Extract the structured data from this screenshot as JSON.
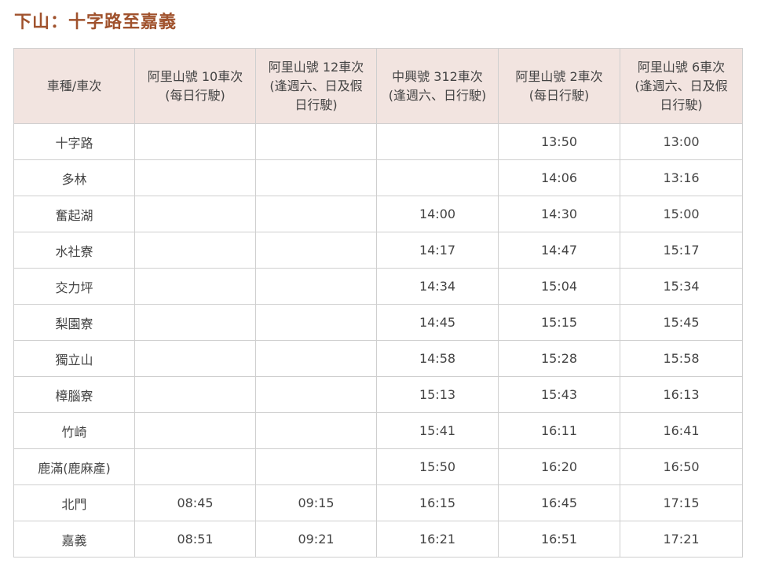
{
  "title": "下山：十字路至嘉義",
  "table": {
    "headers": [
      {
        "lines": [
          "車種/車次"
        ]
      },
      {
        "lines": [
          "阿里山號 10車次",
          "(每日行駛)"
        ]
      },
      {
        "lines": [
          "阿里山號 12車次",
          "(逢週六、日及假",
          "日行駛)"
        ]
      },
      {
        "lines": [
          "中興號 312車次",
          "(逢週六、日行駛)"
        ]
      },
      {
        "lines": [
          "阿里山號 2車次",
          "(每日行駛)"
        ]
      },
      {
        "lines": [
          "阿里山號 6車次",
          "(逢週六、日及假",
          "日行駛)"
        ]
      }
    ],
    "rows": [
      {
        "station": "十字路",
        "times": [
          "",
          "",
          "",
          "13:50",
          "13:00"
        ]
      },
      {
        "station": "多林",
        "times": [
          "",
          "",
          "",
          "14:06",
          "13:16"
        ]
      },
      {
        "station": "奮起湖",
        "times": [
          "",
          "",
          "14:00",
          "14:30",
          "15:00"
        ]
      },
      {
        "station": "水社寮",
        "times": [
          "",
          "",
          "14:17",
          "14:47",
          "15:17"
        ]
      },
      {
        "station": "交力坪",
        "times": [
          "",
          "",
          "14:34",
          "15:04",
          "15:34"
        ]
      },
      {
        "station": "梨園寮",
        "times": [
          "",
          "",
          "14:45",
          "15:15",
          "15:45"
        ]
      },
      {
        "station": "獨立山",
        "times": [
          "",
          "",
          "14:58",
          "15:28",
          "15:58"
        ]
      },
      {
        "station": "樟腦寮",
        "times": [
          "",
          "",
          "15:13",
          "15:43",
          "16:13"
        ]
      },
      {
        "station": "竹崎",
        "times": [
          "",
          "",
          "15:41",
          "16:11",
          "16:41"
        ]
      },
      {
        "station": "鹿滿(鹿麻產)",
        "times": [
          "",
          "",
          "15:50",
          "16:20",
          "16:50"
        ]
      },
      {
        "station": "北門",
        "times": [
          "08:45",
          "09:15",
          "16:15",
          "16:45",
          "17:15"
        ]
      },
      {
        "station": "嘉義",
        "times": [
          "08:51",
          "09:21",
          "16:21",
          "16:51",
          "17:21"
        ]
      }
    ]
  },
  "colors": {
    "title": "#a0522d",
    "header_bg": "#f2e4e0",
    "border": "#cfcfcf"
  }
}
